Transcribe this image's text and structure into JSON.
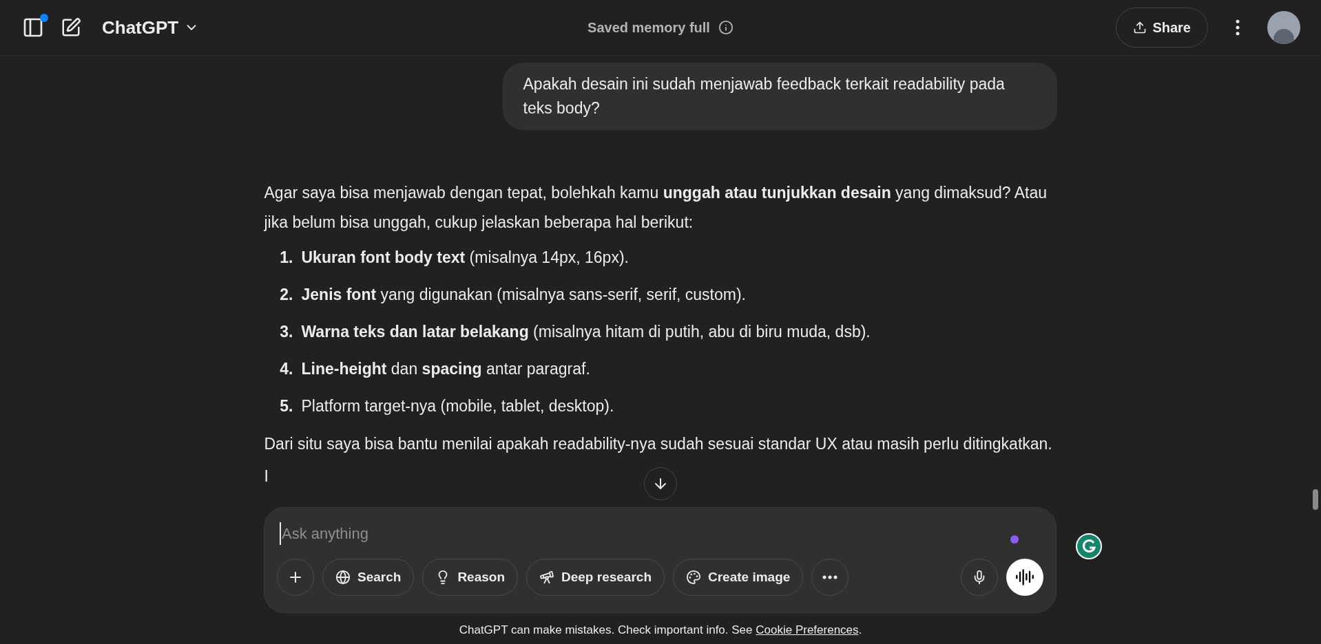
{
  "header": {
    "title": "ChatGPT",
    "memory_notice": "Saved memory full",
    "share": "Share",
    "sidebar_badge": true
  },
  "user_message": {
    "text": "Apakah desain ini sudah menjawab feedback terkait readability pada teks body?"
  },
  "assistant_message": {
    "intro": "Agar saya bisa menjawab dengan tepat, bolehkah kamu **unggah atau tunjukkan desain** yang dimaksud? Atau jika belum bisa unggah, cukup jelaskan beberapa hal berikut:",
    "list": [
      {
        "number": "1.",
        "text": "**Ukuran font body text** (misalnya 14px, 16px)."
      },
      {
        "number": "2.",
        "text": "**Jenis font** yang digunakan (misalnya sans-serif, serif, custom)."
      },
      {
        "number": "3.",
        "text": "**Warna teks dan latar belakang** (misalnya hitam di putih, abu di biru muda, dsb)."
      },
      {
        "number": "4.",
        "text": "**Line-height** dan **spacing** antar paragraf."
      },
      {
        "number": "5.",
        "text": "Platform target-nya (mobile, tablet, desktop)."
      }
    ],
    "outro": "Dari situ saya bisa bantu menilai apakah readability-nya sudah sesuai standar UX atau masih perlu ditingkatkan.",
    "cut_text": "I"
  },
  "composer": {
    "placeholder": "Ask anything",
    "tools": [
      {
        "kind": "search",
        "label": "Search"
      },
      {
        "kind": "reason",
        "label": "Reason"
      },
      {
        "kind": "research",
        "label": "Deep research"
      },
      {
        "kind": "image",
        "label": "Create image"
      }
    ]
  },
  "footer": {
    "text": "ChatGPT can make mistakes. Check important info. See ",
    "link": "Cookie Preferences",
    "end": "."
  }
}
